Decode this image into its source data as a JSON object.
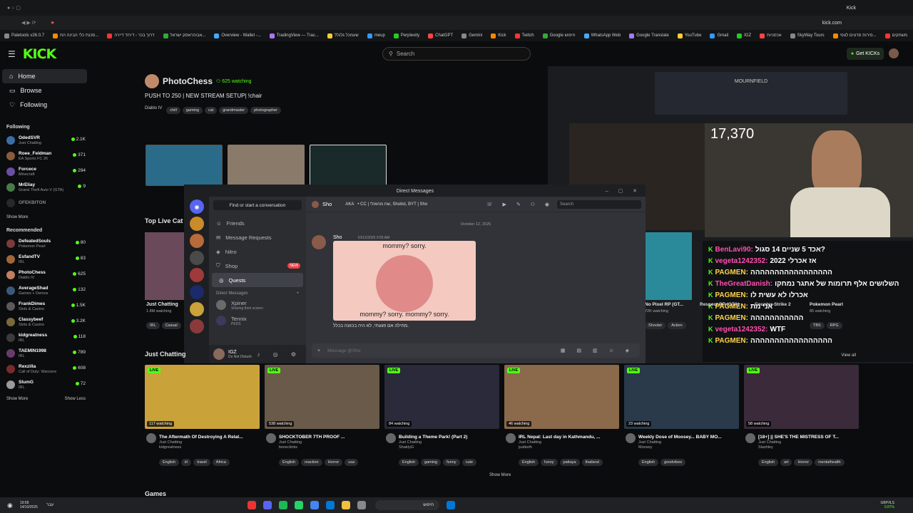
{
  "browser": {
    "tab_title": "Kick",
    "url": "kick.com",
    "bookmarks": [
      "Paletools v26.0.7",
      "סכנת כלי הבינה הת...",
      "דרוך בכר - דירוד דיירה",
      "אבוהראסק ישראל...",
      "Overview - Wallet -...",
      "TradingView — Trac...",
      "שעמכל גלנלל",
      "meup",
      "Perplexity",
      "ChatGPT",
      "Gemini",
      "Kick",
      "Twitch",
      "Google חיפוש",
      "WhatsApp Web",
      "Google Translate",
      "YouTube",
      "Gmail",
      "IGZ",
      "אכסניות",
      "SkyWay Tours",
      "סירות סרטים לצפי...",
      "משחקים",
      "כל הנ"
    ]
  },
  "header": {
    "logo": "KICK",
    "search_placeholder": "Search",
    "get_kicks": "Get KICKs"
  },
  "sidebar": {
    "nav": [
      {
        "label": "Home"
      },
      {
        "label": "Browse"
      },
      {
        "label": "Following"
      }
    ],
    "following_title": "Following",
    "following": [
      {
        "name": "OdedSVR",
        "category": "Just Chatting",
        "count": "2.1K",
        "color": "#3b6ea5"
      },
      {
        "name": "Roee_Feldman",
        "category": "EA Sports FC 26",
        "count": "371",
        "color": "#8a5a3c"
      },
      {
        "name": "Forcece",
        "category": "Minecraft",
        "count": "294",
        "color": "#6b4fa0"
      },
      {
        "name": "MrEliay",
        "category": "Grand Theft Auto V (GTA)",
        "count": "9",
        "color": "#4a7a4a"
      },
      {
        "name": "OFEKBITON",
        "category": "",
        "count": "",
        "color": "#444444"
      }
    ],
    "show_more_1": "Show More",
    "recommended_title": "Recommended",
    "recommended": [
      {
        "name": "DefeatedSouls",
        "category": "Pokemon Pearl",
        "count": "80",
        "color": "#7a3b3b"
      },
      {
        "name": "EsfandTV",
        "category": "IRL",
        "count": "83",
        "color": "#a0663a"
      },
      {
        "name": "PhotoChess",
        "category": "Diablo IV",
        "count": "625",
        "color": "#c08060"
      },
      {
        "name": "AverageShad",
        "category": "Games + Demos",
        "count": "132",
        "color": "#3b5a7a"
      },
      {
        "name": "FrankDimes",
        "category": "Slots & Casino",
        "count": "1.5K",
        "color": "#5a5a5a"
      },
      {
        "name": "Classybeef",
        "category": "Slots & Casino",
        "count": "3.2K",
        "color": "#7a6a3b"
      },
      {
        "name": "kidgreatness",
        "category": "IRL",
        "count": "118",
        "color": "#3b3b3b"
      },
      {
        "name": "TAEMIN1998",
        "category": "IRL",
        "count": "789",
        "color": "#6a3b6a"
      },
      {
        "name": "Rexzilla",
        "category": "Call of Duty: Warzone",
        "count": "608",
        "color": "#7a2a2a"
      },
      {
        "name": "SlumG",
        "category": "IRL",
        "count": "72",
        "color": "#9a9a9a"
      }
    ],
    "show_more_2": "Show More",
    "show_less": "Show Less"
  },
  "featured": {
    "channel": "PhotoChess",
    "watching": "625 watching",
    "title": "PUSH TO 250 | NEW STREAM SETUP| !chair",
    "category": "Diablo IV",
    "tags": [
      "chill",
      "gaming",
      "cat",
      "grandmaster",
      "photographer"
    ]
  },
  "stream_overlay": {
    "viewer_count": "17,370",
    "game_hud": "MOURNFIELD",
    "chat": [
      {
        "user": "BenLavi90:",
        "msg": "אכד 5 שניים 14 סגול?"
      },
      {
        "user": "vegeta1242352:",
        "msg": "2022 אז אכרלי"
      },
      {
        "user": "PAGMEN:",
        "msg": "ההההההההההההההההה"
      },
      {
        "user": "TheGreatDanish:",
        "msg": "השלושים אלף תרומות של אתגר נמחקו"
      },
      {
        "user": "PAGMEN:",
        "msg": "אכרלו לא עשית לו"
      },
      {
        "user": "PAGMEN:",
        "msg": "אני מת"
      },
      {
        "user": "PAGMEN:",
        "msg": "ההההההההההה"
      },
      {
        "user": "vegeta1242352:",
        "msg": "WTF"
      },
      {
        "user": "PAGMEN:",
        "msg": "ההההההההההההההההה"
      }
    ],
    "view_all": "View all"
  },
  "top_live": {
    "title": "Top Live Cat",
    "items": [
      {
        "label": "Just Chatting",
        "watching": "1.8M watching",
        "tags": [
          "IRL",
          "Casual"
        ]
      },
      {
        "label": "No Pixel RP (GT...",
        "watching": "72K watching",
        "tags": [
          "Shooter",
          "Action"
        ]
      },
      {
        "label": "Respect RP (GTA)",
        "watching": "",
        "tags": []
      },
      {
        "label": "Counter-Strike 2",
        "watching": "",
        "tags": []
      },
      {
        "label": "Pokemon Pearl",
        "watching": "85 watching",
        "tags": [
          "TBS",
          "RPG"
        ]
      }
    ]
  },
  "discord": {
    "window_title": "Direct Messages",
    "find_placeholder": "Find or start a conversation",
    "menu": [
      "Friends",
      "Message Requests",
      "Nitro",
      "Shop",
      "Quests"
    ],
    "new_badge": "NEW",
    "dm_header": "Direct Messages",
    "dms": [
      {
        "name": "Xpiner",
        "status": "Sharing their screen"
      },
      {
        "name": "Tennix",
        "status": "PEDS"
      }
    ],
    "user": {
      "name": "IGZ",
      "status": "Do Not Disturb"
    },
    "chat_user": "Sho",
    "chat_aka": "AKA",
    "chat_topic": "• CC | שח מהאזלי, Shotist, BYT | Sho",
    "search_placeholder": "Search",
    "date_divider": "October 12, 2025",
    "message": {
      "author": "Sho",
      "timestamp": "10/12/2025 9:55 AM",
      "meme_top": "mommy? sorry.",
      "meme_bottom": "mommy? sorry. mommy? sorry.",
      "caption": "מחילה אם פגעתי, לא היה בכוונה בכלל."
    },
    "input_placeholder": "Message @Sho"
  },
  "just_chatting": {
    "title": "Just Chatting",
    "cards": [
      {
        "watching": "117 watching",
        "title": "The Aftermath Of Destroying A Relat...",
        "category": "Just Chatting",
        "user": "kidgreatness",
        "tags": [
          "English",
          "irl",
          "travel",
          "Africa"
        ],
        "color": "#c9a23a"
      },
      {
        "watching": "538 watching",
        "title": "SHOCKTOBER 7TH PROOF ...",
        "category": "Just Chatting",
        "user": "boneclinks",
        "tags": [
          "English",
          "reaction",
          "Horror",
          "usa"
        ],
        "color": "#6a5a4a"
      },
      {
        "watching": "84 watching",
        "title": "Building a Theme Park! (Part 2)",
        "category": "Just Chatting",
        "user": "ShaktyG",
        "tags": [
          "English",
          "gaming",
          "funny",
          "cute"
        ],
        "color": "#2a2a3a"
      },
      {
        "watching": "46 watching",
        "title": "IRL Nepal: Last day in Kathmandu, ...",
        "category": "Just Chatting",
        "user": "justketh",
        "tags": [
          "English",
          "funny",
          "pattaya",
          "thailand"
        ],
        "color": "#8a6a4a"
      },
      {
        "watching": "23 watching",
        "title": "Weekly Dose of Moosey... BABY MO...",
        "category": "Just Chatting",
        "user": "Moosey",
        "tags": [
          "English",
          "goodvibes"
        ],
        "color": "#2a3a4a"
      },
      {
        "watching": "58 watching",
        "title": "[18+] || SHE'S THE MISTRESS OF T...",
        "category": "Just Chatting",
        "user": "Slashley",
        "tags": [
          "English",
          "art",
          "Horror",
          "mentalhealth"
        ],
        "color": "#3a2a3a"
      }
    ],
    "live_label": "LIVE",
    "show_more": "Show More"
  },
  "games_title": "Games",
  "taskbar": {
    "time": "19:58",
    "date": "14/10/2025",
    "lang": "עבר",
    "search": "חיפוש",
    "currency": "GBP/ILS",
    "change": "0.87%"
  }
}
